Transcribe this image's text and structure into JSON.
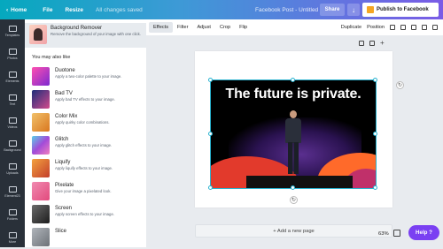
{
  "topbar": {
    "home": "Home",
    "file": "File",
    "resize": "Resize",
    "status": "All changes saved",
    "doc_title": "Facebook Post - Untitled",
    "share": "Share",
    "publish": "Publish to Facebook"
  },
  "sidebar": {
    "items": [
      {
        "label": "Templates",
        "icon": "templates-icon"
      },
      {
        "label": "Photos",
        "icon": "photos-icon"
      },
      {
        "label": "Elements",
        "icon": "elements-icon"
      },
      {
        "label": "Text",
        "icon": "text-icon"
      },
      {
        "label": "Videos",
        "icon": "videos-icon"
      },
      {
        "label": "Background",
        "icon": "background-icon"
      },
      {
        "label": "Uploads",
        "icon": "uploads-icon"
      },
      {
        "label": "Element23",
        "icon": "element23-icon"
      },
      {
        "label": "Folders",
        "icon": "folders-icon"
      },
      {
        "label": "More",
        "icon": "more-icon"
      }
    ]
  },
  "panel": {
    "bg_remover": {
      "title": "Background Remover",
      "desc": "Remove the background of your image with one click."
    },
    "also_like": "You may also like",
    "effects": [
      {
        "title": "Duotone",
        "desc": "Apply a two-color palette to your image.",
        "color": "#e63aa0"
      },
      {
        "title": "Bad TV",
        "desc": "Apply bad TV effects to your image.",
        "color": "#2b3c88"
      },
      {
        "title": "Color Mix",
        "desc": "Apply quirky color combinations.",
        "color": "#e2a04a"
      },
      {
        "title": "Glitch",
        "desc": "Apply glitch effects to your image.",
        "color": "#9b5bd6"
      },
      {
        "title": "Liquify",
        "desc": "Apply liquify effects to your image.",
        "color": "#d86a2b"
      },
      {
        "title": "Pixelate",
        "desc": "Give your image a pixelated look.",
        "color": "#e06288"
      },
      {
        "title": "Screen",
        "desc": "Apply screen effects to your image.",
        "color": "#2c2c2c"
      },
      {
        "title": "Slice",
        "desc": "",
        "color": "#8a8f96"
      }
    ]
  },
  "toolbar": {
    "effects": "Effects",
    "filter": "Filter",
    "adjust": "Adjust",
    "crop": "Crop",
    "flip": "Flip",
    "duplicate": "Duplicate",
    "position": "Position"
  },
  "canvas": {
    "photo_text": "The future is private.",
    "add_page": "+ Add a new page",
    "zoom": "63%"
  },
  "help": "Help ?"
}
